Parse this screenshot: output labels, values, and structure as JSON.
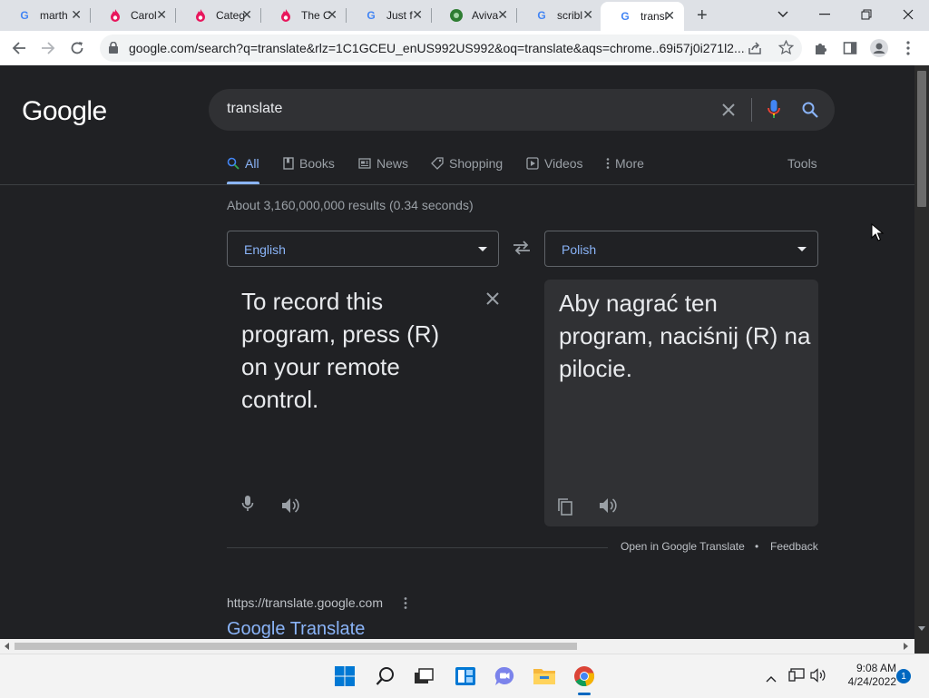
{
  "browser": {
    "tabs": [
      {
        "label": "marth",
        "favicon": "google-icon"
      },
      {
        "label": "Carol",
        "favicon": "flame-icon"
      },
      {
        "label": "Categ",
        "favicon": "flame-icon"
      },
      {
        "label": "The C",
        "favicon": "flame-icon"
      },
      {
        "label": "Just f",
        "favicon": "google-icon"
      },
      {
        "label": "Aviva",
        "favicon": "globe-icon"
      },
      {
        "label": "scribl",
        "favicon": "google-icon"
      },
      {
        "label": "transl",
        "favicon": "google-icon",
        "active": true
      }
    ],
    "url": "google.com/search?q=translate&rlz=1C1GCEU_enUS992US992&oq=translate&aqs=chrome..69i57j0i271l2...."
  },
  "search": {
    "logo": "Google",
    "query": "translate",
    "nav": [
      "All",
      "Books",
      "News",
      "Shopping",
      "Videos",
      "More"
    ],
    "tools": "Tools",
    "stats": "About 3,160,000,000 results (0.34 seconds)"
  },
  "translate": {
    "source_lang": "English",
    "target_lang": "Polish",
    "source_text": "To record this program, press (R) on your remote control.",
    "target_text": "Aby nagrać ten program, naciśnij (R) na pilocie.",
    "open_link": "Open in Google Translate",
    "separator": "•",
    "feedback": "Feedback"
  },
  "result": {
    "url": "https://translate.google.com",
    "title": "Google Translate"
  },
  "taskbar": {
    "time": "9:08 AM",
    "date": "4/24/2022",
    "notifications": "1"
  },
  "colors": {
    "page_bg": "#202124",
    "link": "#8ab4f8",
    "text": "#e8eaed",
    "muted": "#9aa0a6"
  }
}
